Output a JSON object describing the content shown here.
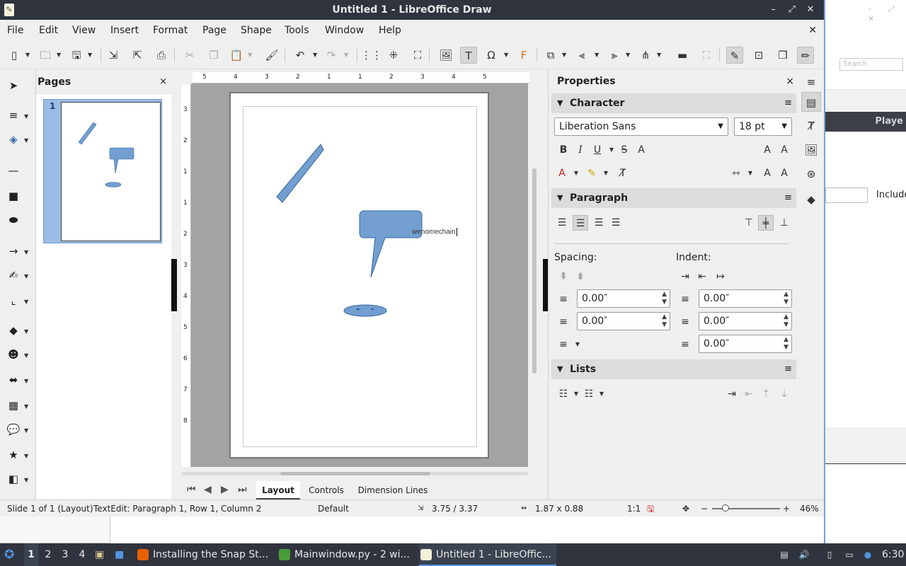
{
  "window": {
    "title": "Untitled 1 - LibreOffice Draw",
    "controls": [
      "–",
      "⤢",
      "✕"
    ]
  },
  "menu": {
    "items": [
      "File",
      "Edit",
      "View",
      "Insert",
      "Format",
      "Page",
      "Shape",
      "Tools",
      "Window",
      "Help"
    ],
    "close": "✕"
  },
  "pages_panel": {
    "title": "Pages",
    "close": "×",
    "page_number": "1"
  },
  "ruler": {
    "horizontal": [
      "5",
      "4",
      "3",
      "2",
      "1",
      "1",
      "2",
      "3",
      "4",
      "5"
    ],
    "vertical": [
      "3",
      "2",
      "1",
      "1",
      "2",
      "3",
      "4",
      "5",
      "6",
      "7",
      "8"
    ]
  },
  "canvas": {
    "text_box": "wenomechain",
    "shape_color": "#729fcf",
    "shape_stroke": "#3465a4"
  },
  "tabs": {
    "items": [
      "Layout",
      "Controls",
      "Dimension Lines"
    ],
    "active": "Layout"
  },
  "properties": {
    "title": "Properties",
    "close": "×",
    "character": {
      "label": "Character",
      "font_name": "Liberation Sans",
      "font_size": "18 pt"
    },
    "paragraph": {
      "label": "Paragraph",
      "spacing_label": "Spacing:",
      "indent_label": "Indent:",
      "above_spacing": "0.00″",
      "below_spacing": "0.00″",
      "before_indent": "0.00″",
      "after_indent": "0.00″",
      "first_line_indent": "0.00″"
    },
    "lists": {
      "label": "Lists"
    }
  },
  "statusbar": {
    "slide": "Slide 1 of 1 (Layout)",
    "textedit": "TextEdit: Paragraph 1, Row 1, Column 2",
    "master": "Default",
    "position": "3.75 / 3.37",
    "size": "1.87 x 0.88",
    "scale": "1:1",
    "zoom": "46%"
  },
  "background_app": {
    "search_placeholder": "Search",
    "band_label": "Playe",
    "include_label": "Include"
  },
  "taskbar": {
    "workspaces": [
      "1",
      "2",
      "3",
      "4"
    ],
    "active_workspace": "1",
    "tasks": [
      {
        "label": "Installing the Snap St...",
        "icon_color": "#e66000"
      },
      {
        "label": "Mainwindow.py - 2 wi...",
        "icon_color": "#4a9c3b"
      },
      {
        "label": "Untitled 1 - LibreOffic...",
        "icon_color": "#f5f0d8"
      }
    ],
    "active_task_index": 2,
    "clock": "6:30"
  },
  "colors": {
    "titlebar": "#2f343f",
    "accent": "#5294e2",
    "window_bg": "#efefef",
    "workspace_bg": "#a3a3a3"
  }
}
